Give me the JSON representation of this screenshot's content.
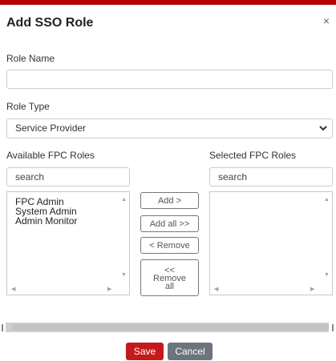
{
  "dialog": {
    "title": "Add SSO Role",
    "close_glyph": "×"
  },
  "role_name": {
    "label": "Role Name",
    "value": "",
    "placeholder": ""
  },
  "role_type": {
    "label": "Role Type",
    "selected": "Service Provider",
    "icon": "chevron-down-icon"
  },
  "available": {
    "label": "Available FPC Roles",
    "search_placeholder": "search",
    "items": [
      "FPC Admin",
      "System Admin",
      "Admin Monitor"
    ]
  },
  "selected": {
    "label": "Selected FPC Roles",
    "search_placeholder": "search",
    "items": []
  },
  "transfer": {
    "add": "Add >",
    "add_all": "Add all >>",
    "remove": "< Remove",
    "remove_all_lines": [
      "<<",
      "Remove",
      "all"
    ]
  },
  "footer": {
    "save": "Save",
    "cancel": "Cancel"
  },
  "colors": {
    "accent_bar": "#b00000",
    "save_button": "#c41a1a",
    "cancel_button": "#6c757d"
  }
}
